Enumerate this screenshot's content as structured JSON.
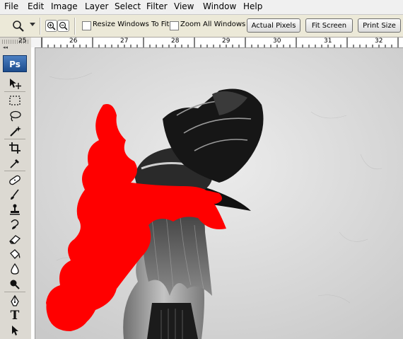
{
  "menu": [
    "File",
    "Edit",
    "Image",
    "Layer",
    "Select",
    "Filter",
    "View",
    "Window",
    "Help"
  ],
  "options_bar": {
    "tool_icon": "zoom-icon",
    "zoom_in_icon": "zoom-in-icon",
    "zoom_out_icon": "zoom-out-icon",
    "resize_windows_label": "Resize Windows To Fit",
    "zoom_all_windows_label": "Zoom All Windows",
    "actual_pixels_label": "Actual Pixels",
    "fit_screen_label": "Fit Screen",
    "print_size_label": "Print Size"
  },
  "ruler": {
    "labels": [
      "25",
      "26",
      "27",
      "28",
      "29",
      "30",
      "31",
      "32"
    ]
  },
  "toolbox": {
    "logo": "Ps",
    "tools": [
      "move-icon",
      "marquee-icon",
      "lasso-icon",
      "magic-wand-icon",
      "crop-icon",
      "eyedropper-icon",
      "healing-brush-icon",
      "brush-icon",
      "clone-stamp-icon",
      "history-brush-icon",
      "eraser-icon",
      "paint-bucket-icon",
      "blur-icon",
      "dodge-icon",
      "pen-icon",
      "type-icon"
    ],
    "type_label": "T"
  },
  "colors": {
    "paint": "#ff0000",
    "canvas": "#dcdcdc",
    "ps_blue": "#2a5ea8"
  }
}
